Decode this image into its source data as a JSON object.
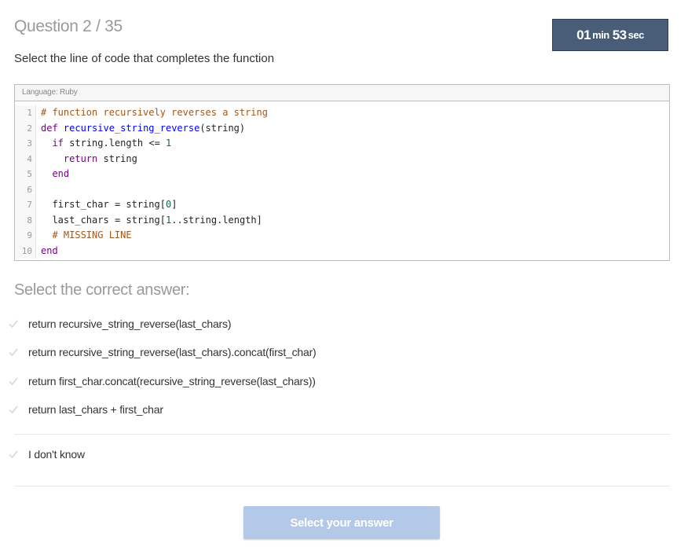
{
  "header": {
    "question_label": "Question 2 / 35",
    "timer": {
      "minutes": "01",
      "minutes_unit": "min",
      "seconds": "53",
      "seconds_unit": "sec"
    }
  },
  "prompt": "Select the line of code that completes the function",
  "code": {
    "language_label": "Language: Ruby",
    "line_numbers": [
      "1",
      "2",
      "3",
      "4",
      "5",
      "6",
      "7",
      "8",
      "9",
      "10"
    ],
    "lines": [
      "# function recursively reverses a string",
      "def recursive_string_reverse(string)",
      "  if string.length <= 1",
      "    return string",
      "  end",
      "",
      "  first_char = string[0]",
      "  last_chars = string[1..string.length]",
      "  # MISSING LINE",
      "end"
    ]
  },
  "answers_heading": "Select the correct answer:",
  "answers": [
    {
      "label": "return recursive_string_reverse(last_chars)"
    },
    {
      "label": "return recursive_string_reverse(last_chars).concat(first_char)"
    },
    {
      "label": "return first_char.concat(recursive_string_reverse(last_chars))"
    },
    {
      "label": "return last_chars + first_char"
    }
  ],
  "dont_know": {
    "label": "I don't know"
  },
  "submit_label": "Select your answer",
  "colors": {
    "timer_bg": "#4a5d78",
    "submit_disabled": "#b3c9e7",
    "check_icon": "#d6d6d6"
  }
}
